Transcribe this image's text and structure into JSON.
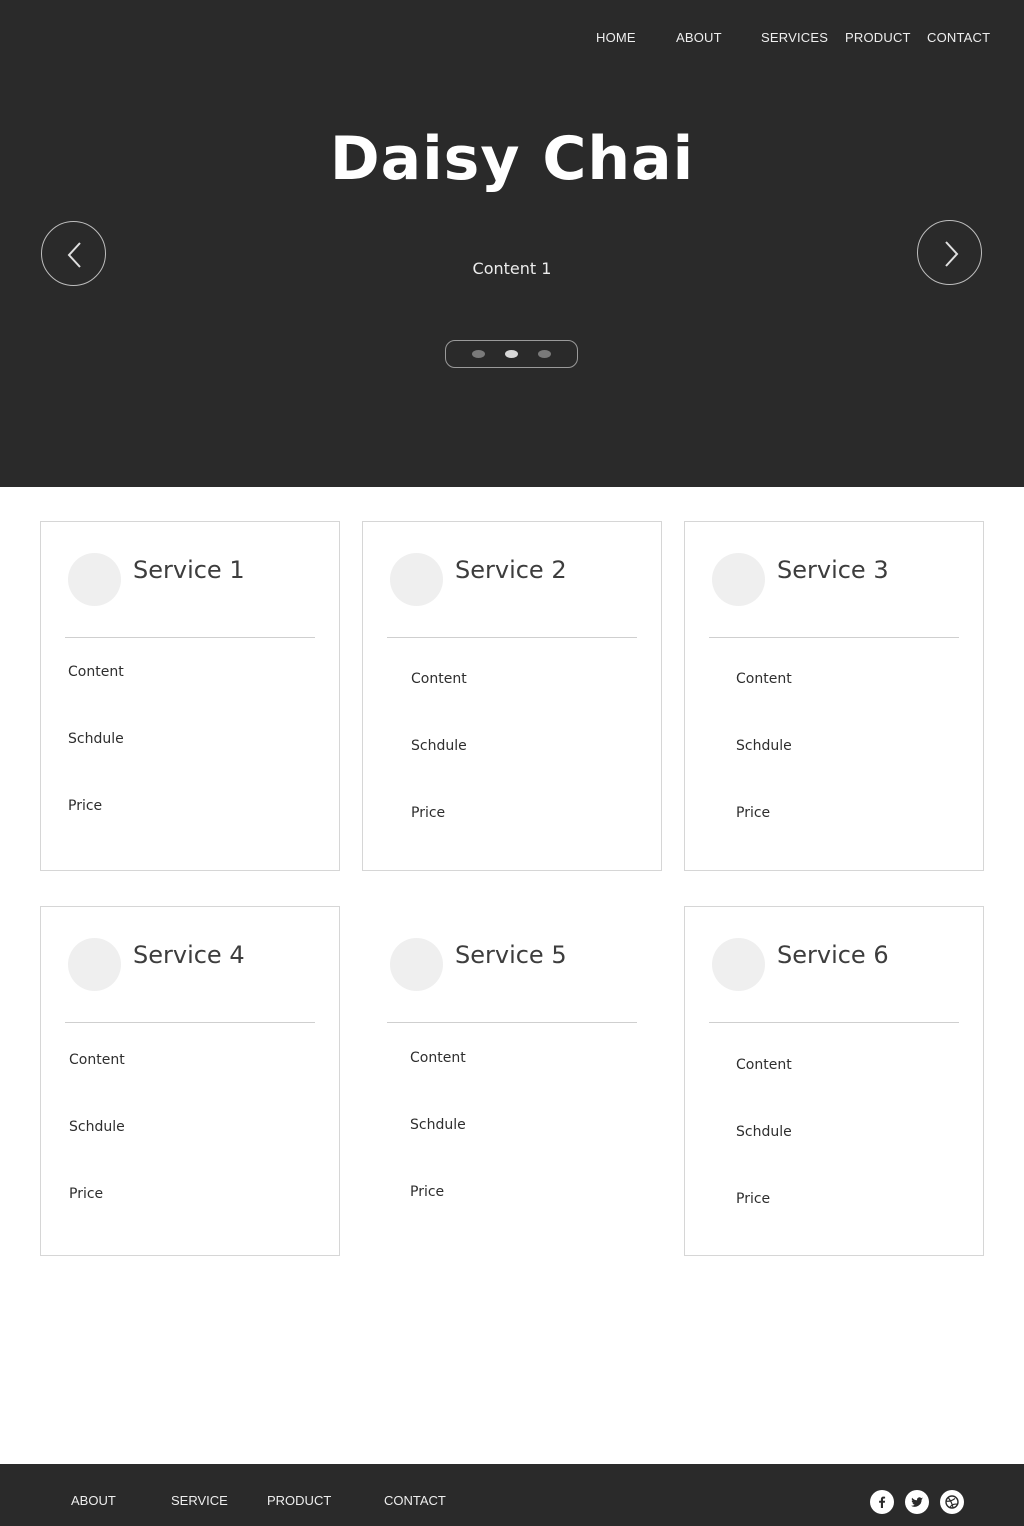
{
  "nav": {
    "items": [
      {
        "label": "HOME"
      },
      {
        "label": "ABOUT"
      },
      {
        "label": "SERVICES"
      },
      {
        "label": "PRODUCT"
      },
      {
        "label": "CONTACT"
      }
    ]
  },
  "hero": {
    "title": "Daisy Chai",
    "subtitle": "Content 1",
    "active_slide": 2,
    "slide_count": 3
  },
  "services": [
    {
      "title": "Service 1",
      "content": "Content",
      "schedule": "Schdule",
      "price": "Price"
    },
    {
      "title": "Service 2",
      "content": "Content",
      "schedule": "Schdule",
      "price": "Price"
    },
    {
      "title": "Service 3",
      "content": "Content",
      "schedule": "Schdule",
      "price": "Price"
    },
    {
      "title": "Service 4",
      "content": "Content",
      "schedule": "Schdule",
      "price": "Price"
    },
    {
      "title": "Service 5",
      "content": "Content",
      "schedule": "Schdule",
      "price": "Price"
    },
    {
      "title": "Service 6",
      "content": "Content",
      "schedule": "Schdule",
      "price": "Price"
    }
  ],
  "footer": {
    "links": [
      {
        "label": "ABOUT"
      },
      {
        "label": "SERVICE"
      },
      {
        "label": "PRODUCT"
      },
      {
        "label": "CONTACT"
      }
    ],
    "social": [
      "facebook-icon",
      "twitter-icon",
      "dribbble-icon"
    ]
  },
  "colors": {
    "dark_bg": "#2a2a2a",
    "card_border": "#d6d6d6",
    "avatar": "#efefef",
    "dot_active": "#d8d8d8",
    "dot_inactive": "#7a7a7a"
  }
}
